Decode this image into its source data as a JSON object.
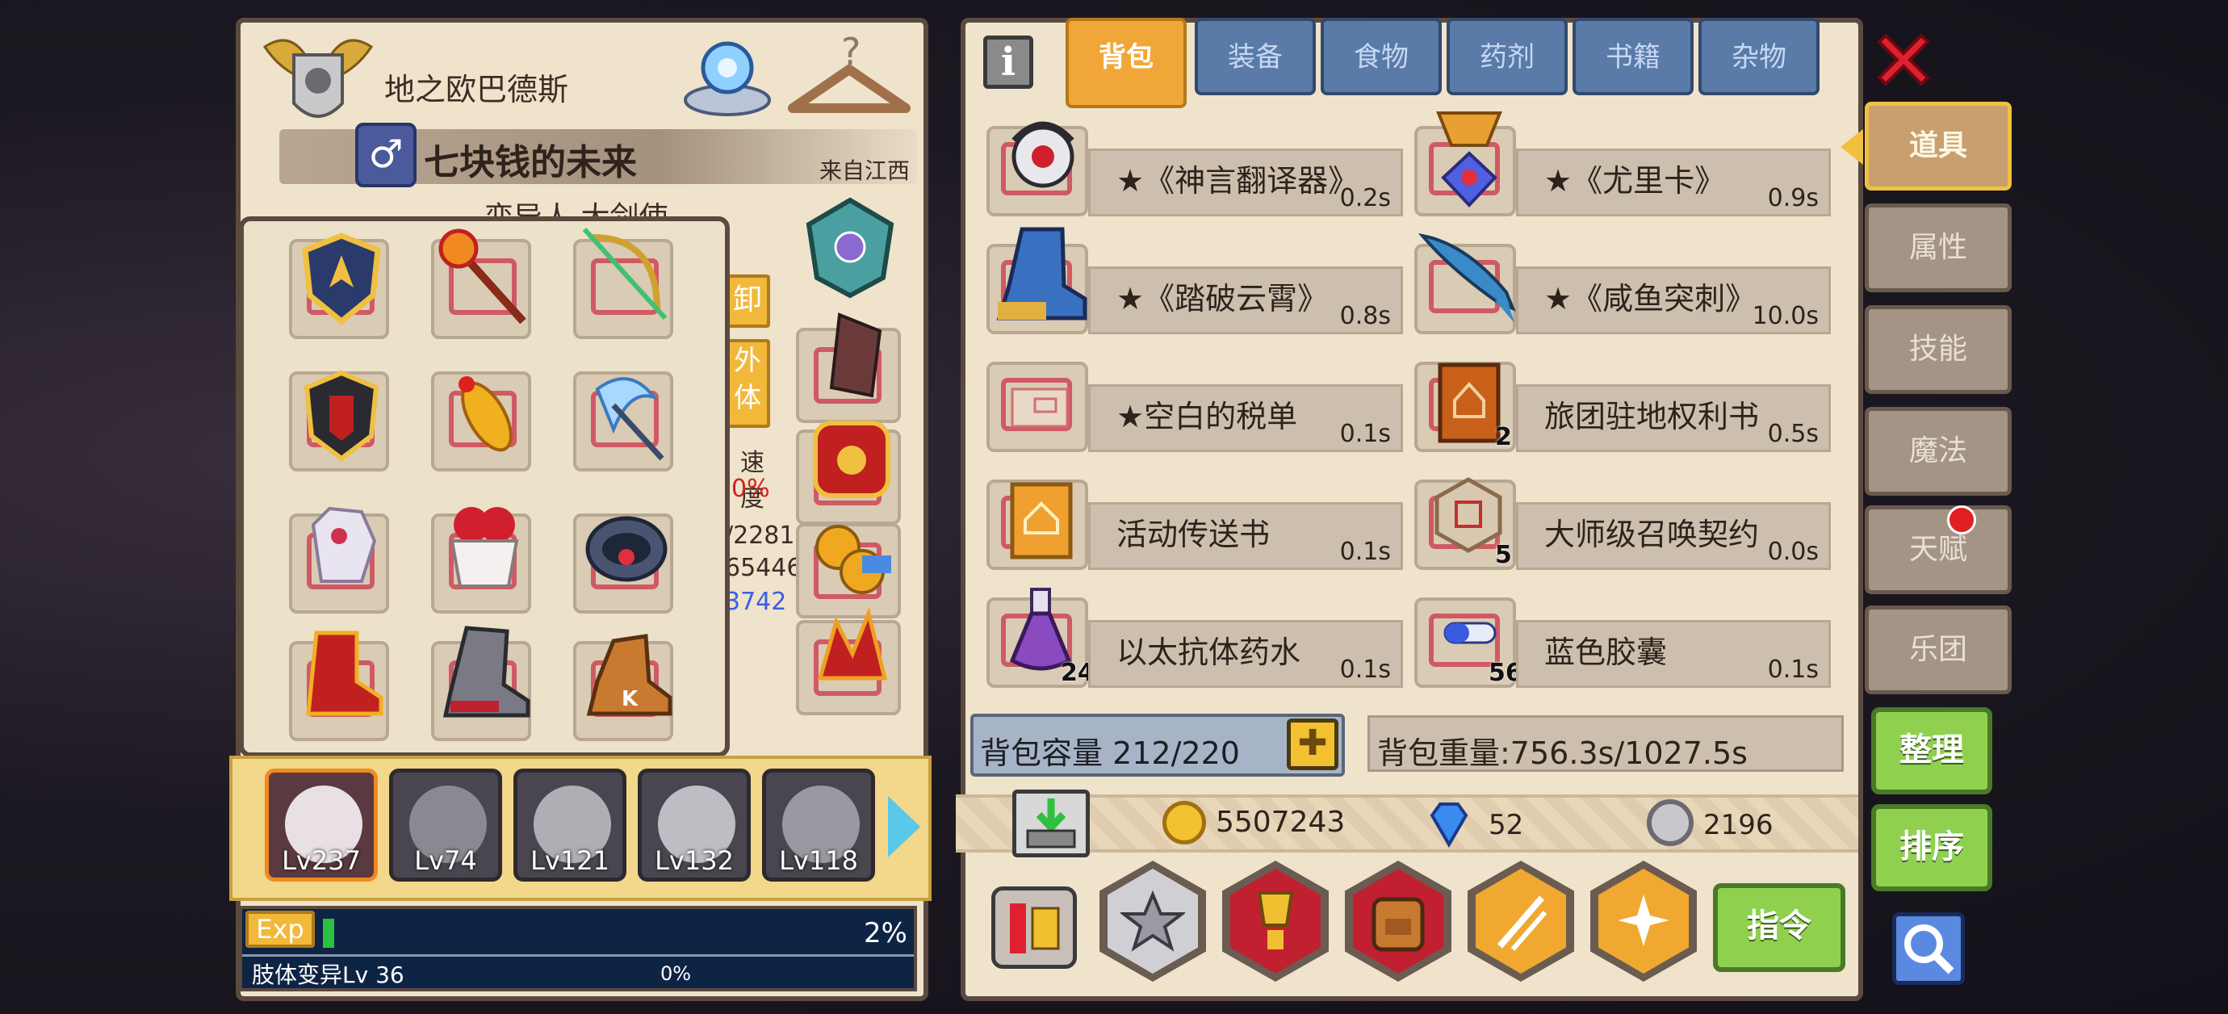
{
  "character": {
    "name": "地之欧巴德斯",
    "title": "七块钱的未来",
    "origin": "来自江西",
    "subtitle": "变异人 大剑使"
  },
  "hidden_stats": {
    "btn1": "卸",
    "btn2": "外",
    "btn3": "体",
    "label": "速度",
    "pct": "0%",
    "v1": "/2281",
    "v2": "65446",
    "v3": "3742"
  },
  "party": [
    {
      "level": "Lv237"
    },
    {
      "level": "Lv74"
    },
    {
      "level": "Lv121"
    },
    {
      "level": "Lv132"
    },
    {
      "level": "Lv118"
    }
  ],
  "exp": {
    "label": "Exp",
    "percent": "2%",
    "skill": "肢体变异Lv 36",
    "skill_percent": "0%"
  },
  "tabs": [
    "背包",
    "装备",
    "食物",
    "药剂",
    "书籍",
    "杂物"
  ],
  "side_tabs": [
    "道具",
    "属性",
    "技能",
    "魔法",
    "天赋",
    "乐团"
  ],
  "items": [
    {
      "name": "★《神言翻译器》",
      "weight": "0.2s",
      "count": ""
    },
    {
      "name": "★《尤里卡》",
      "weight": "0.9s",
      "count": ""
    },
    {
      "name": "★《踏破云霄》",
      "weight": "0.8s",
      "count": ""
    },
    {
      "name": "★《咸鱼突刺》",
      "weight": "10.0s",
      "count": ""
    },
    {
      "name": "★空白的税单",
      "weight": "0.1s",
      "count": ""
    },
    {
      "name": "旅团驻地权利书",
      "weight": "0.5s",
      "count": "2"
    },
    {
      "name": "活动传送书",
      "weight": "0.1s",
      "count": ""
    },
    {
      "name": "大师级召唤契约",
      "weight": "0.0s",
      "count": "5"
    },
    {
      "name": "以太抗体药水",
      "weight": "0.1s",
      "count": "24"
    },
    {
      "name": "蓝色胶囊",
      "weight": "0.1s",
      "count": "56"
    }
  ],
  "capacity": {
    "label": "背包容量 212/220",
    "plus": "✚"
  },
  "weight": {
    "label": "背包重量:756.3s/1027.5s"
  },
  "currency": {
    "gold": "5507243",
    "diamond": "52",
    "silver": "2196"
  },
  "buttons": {
    "sort_arrange": "整理",
    "sort_order": "排序",
    "command": "指令"
  },
  "colors": {
    "tab_active": "#f1a738",
    "tab_inactive": "#5a7aa8",
    "slot_border": "#cf5a63",
    "green": "#8fd14f",
    "notice_dot": "#e02020"
  }
}
